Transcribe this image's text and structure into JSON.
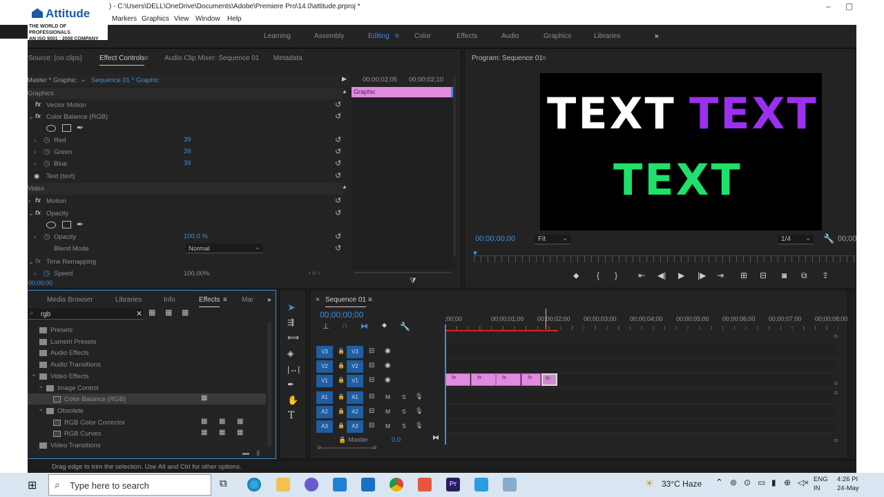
{
  "titlebar": {
    "path": ") - C:\\Users\\DELL\\OneDrive\\Documents\\Adobe\\Premiere Pro\\14.0\\attitude.prproj *",
    "logo_brand": "Attitude",
    "logo_tag1": "THE WORLD OF PROFESSIONALS",
    "logo_tag2": "AN ISO 9001 : 2008 COMPANY"
  },
  "menu": [
    "Markers",
    "Graphics",
    "View",
    "Window",
    "Help"
  ],
  "workspaces": [
    "Learning",
    "Assembly",
    "Editing",
    "Color",
    "Effects",
    "Audio",
    "Graphics",
    "Libraries"
  ],
  "workspaces_active": "Editing",
  "effect_panel": {
    "tabs": [
      "Source: (no clips)",
      "Effect Controls",
      "Audio Clip Mixer: Sequence 01",
      "Metadata"
    ],
    "master": "Master * Graphic",
    "sequence": "Sequence 01 * Graphic",
    "tc1": "00;00;02;05",
    "tc2": "00;00;02;10",
    "clip_label": "Graphic",
    "section_graphics": "Graphics",
    "vector_motion": "Vector Motion",
    "color_balance": "Color Balance (RGB)",
    "red_label": "Red",
    "red": "39",
    "green_label": "Green",
    "green": "39",
    "blue_label": "Blue",
    "blue": "39",
    "text_layer": "Text (text)",
    "section_video": "Video",
    "motion": "Motion",
    "opacity": "Opacity",
    "opacity_label": "Opacity",
    "opacity_val": "100.0 %",
    "blend_label": "Blend Mode",
    "blend_val": "Normal",
    "time_remap": "Time Remapping",
    "speed_label": "Speed",
    "speed_val": "100.00%",
    "timecode": "00;00;00"
  },
  "program": {
    "title": "Program: Sequence 01",
    "line1_a": "TEXT",
    "line1_b": "TEXT",
    "line2": "TEXT",
    "timecode": "00;00;00;00",
    "fit": "Fit",
    "res": "1/4",
    "tc_right": "00;00"
  },
  "colors": {
    "white": "#ffffff",
    "purple": "#9b30f0",
    "green": "#1ee06a",
    "accent": "#3d8fe0",
    "clip": "#e08be0"
  },
  "project": {
    "tabs": [
      "Media Browser",
      "Libraries",
      "Info",
      "Effects",
      "Mar"
    ],
    "search": "rgb",
    "items": [
      {
        "label": "Presets"
      },
      {
        "label": "Lumetri Presets"
      },
      {
        "label": "Audio Effects"
      },
      {
        "label": "Audio Transitions"
      },
      {
        "label": "Video Effects"
      },
      {
        "label": "Image Control"
      },
      {
        "label": "Color Balance (RGB)"
      },
      {
        "label": "Obsolete"
      },
      {
        "label": "RGB Color Corrector"
      },
      {
        "label": "RGB Curves"
      },
      {
        "label": "Video Transitions"
      }
    ]
  },
  "timeline": {
    "title": "Sequence 01",
    "timecode": "00;00;00;00",
    "ruler": [
      ";00;00",
      "00;00;01;00",
      "00;00;02;00",
      "00;00;03;00",
      "00;00;04;00",
      "00;00;05;00",
      "00;00;06;00",
      "00;00;07;00",
      "00;00;08;00"
    ],
    "video_tracks": [
      "V3",
      "V2",
      "V1"
    ],
    "audio_tracks": [
      "A1",
      "A2",
      "A3"
    ],
    "master": "Master",
    "master_val": "0.0",
    "m": "M",
    "s": "S",
    "fx": "fx"
  },
  "status": "Drag edge to trim the selection. Use Alt and Ctrl for other options.",
  "taskbar": {
    "search": "Type here to search",
    "weather": "33°C  Haze",
    "lang1": "ENG",
    "lang2": "IN",
    "time": "4:26 PI",
    "date": "24-May"
  }
}
